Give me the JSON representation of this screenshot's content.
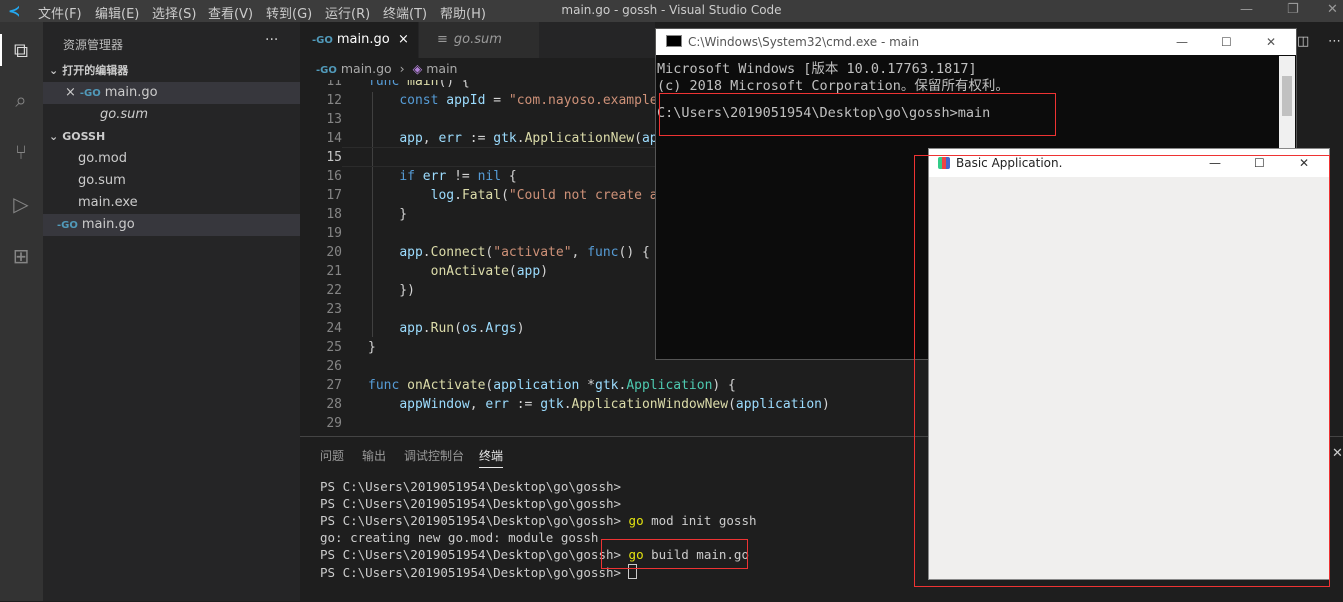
{
  "titlebar": {
    "title": "main.go - gossh - Visual Studio Code",
    "menu": [
      "文件(F)",
      "编辑(E)",
      "选择(S)",
      "查看(V)",
      "转到(G)",
      "运行(R)",
      "终端(T)",
      "帮助(H)"
    ]
  },
  "sidebar": {
    "header": "资源管理器",
    "more": "···",
    "open_editors_title": "打开的编辑器",
    "open_editors": [
      {
        "icon": "go",
        "name": "main.go",
        "close": "×"
      },
      {
        "name": "go.sum"
      }
    ],
    "folder_title": "GOSSH",
    "files": [
      {
        "name": "go.mod"
      },
      {
        "name": "go.sum"
      },
      {
        "name": "main.exe"
      },
      {
        "icon": "go",
        "name": "main.go"
      }
    ]
  },
  "editor": {
    "tabs": [
      {
        "icon": "-GO",
        "label": "main.go",
        "close": "×"
      },
      {
        "label": "go.sum"
      }
    ],
    "breadcrumb": {
      "file": "main.go",
      "sep": "›",
      "symbol": "main"
    },
    "line_numbers": [
      "11",
      "12",
      "13",
      "14",
      "15",
      "16",
      "17",
      "18",
      "19",
      "20",
      "21",
      "22",
      "23",
      "24",
      "25",
      "26",
      "27",
      "28",
      "29"
    ]
  },
  "panel": {
    "tabs": [
      "问题",
      "输出",
      "调试控制台",
      "终端"
    ],
    "active_tab": "终端",
    "terminal": [
      {
        "prompt": "PS C:\\Users\\2019051954\\Desktop\\go\\gossh>",
        "cmd_kw": "",
        "cmd_rest": ""
      },
      {
        "prompt": "PS C:\\Users\\2019051954\\Desktop\\go\\gossh>",
        "cmd_kw": "",
        "cmd_rest": ""
      },
      {
        "prompt": "PS C:\\Users\\2019051954\\Desktop\\go\\gossh>",
        "cmd_kw": " go",
        "cmd_rest": " mod init gossh"
      },
      {
        "prompt": "go: creating new go.mod: module gossh",
        "cmd_kw": "",
        "cmd_rest": ""
      },
      {
        "prompt": "PS C:\\Users\\2019051954\\Desktop\\go\\gossh>",
        "cmd_kw": " go",
        "cmd_rest": " build main.go"
      },
      {
        "prompt": "PS C:\\Users\\2019051954\\Desktop\\go\\gossh>",
        "cmd_kw": "",
        "cmd_rest": ""
      }
    ]
  },
  "cmd": {
    "title": "C:\\Windows\\System32\\cmd.exe - main",
    "lines": [
      "Microsoft Windows [版本 10.0.17763.1817]",
      "(c) 2018 Microsoft Corporation。保留所有权利。",
      "",
      "C:\\Users\\2019051954\\Desktop\\go\\gossh>main"
    ]
  },
  "gtk": {
    "title": "Basic Application."
  },
  "colors": {
    "accent": "#007acc",
    "highlight_box": "#e33333"
  }
}
